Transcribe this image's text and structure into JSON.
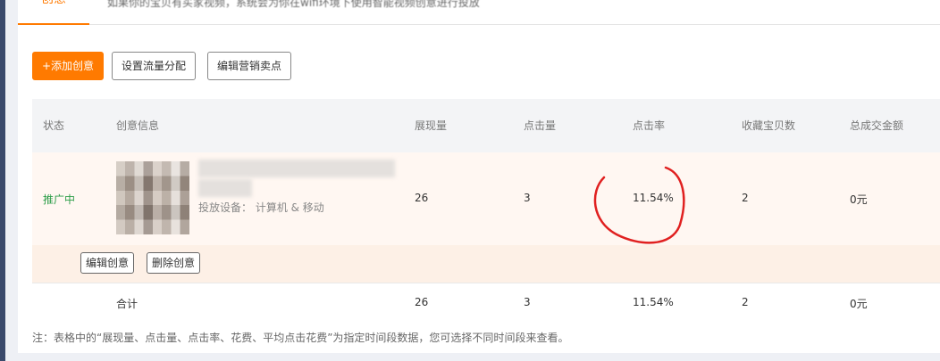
{
  "tab": {
    "label": "创意",
    "notice": "如果你的宝贝有买家视频，系统会为你在wifi环境下使用智能视频创意进行投放"
  },
  "toolbar": {
    "add_label": "+添加创意",
    "traffic_label": "设置流量分配",
    "selling_label": "编辑营销卖点"
  },
  "table": {
    "headers": [
      "状态",
      "创意信息",
      "展现量",
      "点击量",
      "点击率",
      "收藏宝贝数",
      "总成交金额"
    ],
    "rows": [
      {
        "status": "推广中",
        "device": "投放设备：  计算机 & 移动",
        "impressions": "26",
        "clicks": "3",
        "ctr": "11.54%",
        "favorites": "2",
        "gmv": "0元",
        "edit_label": "编辑创意",
        "delete_label": "删除创意"
      }
    ],
    "total": {
      "label": "合计",
      "impressions": "26",
      "clicks": "3",
      "ctr": "11.54%",
      "favorites": "2",
      "gmv": "0元"
    }
  },
  "note": "注：表格中的“展现量、点击量、点击率、花费、平均点击花费”为指定时间段数据，您可选择不同时间段来查看。",
  "colors": {
    "accent": "#ff7a00",
    "status_active": "#2e9e4a",
    "annotation": "#e02020"
  }
}
